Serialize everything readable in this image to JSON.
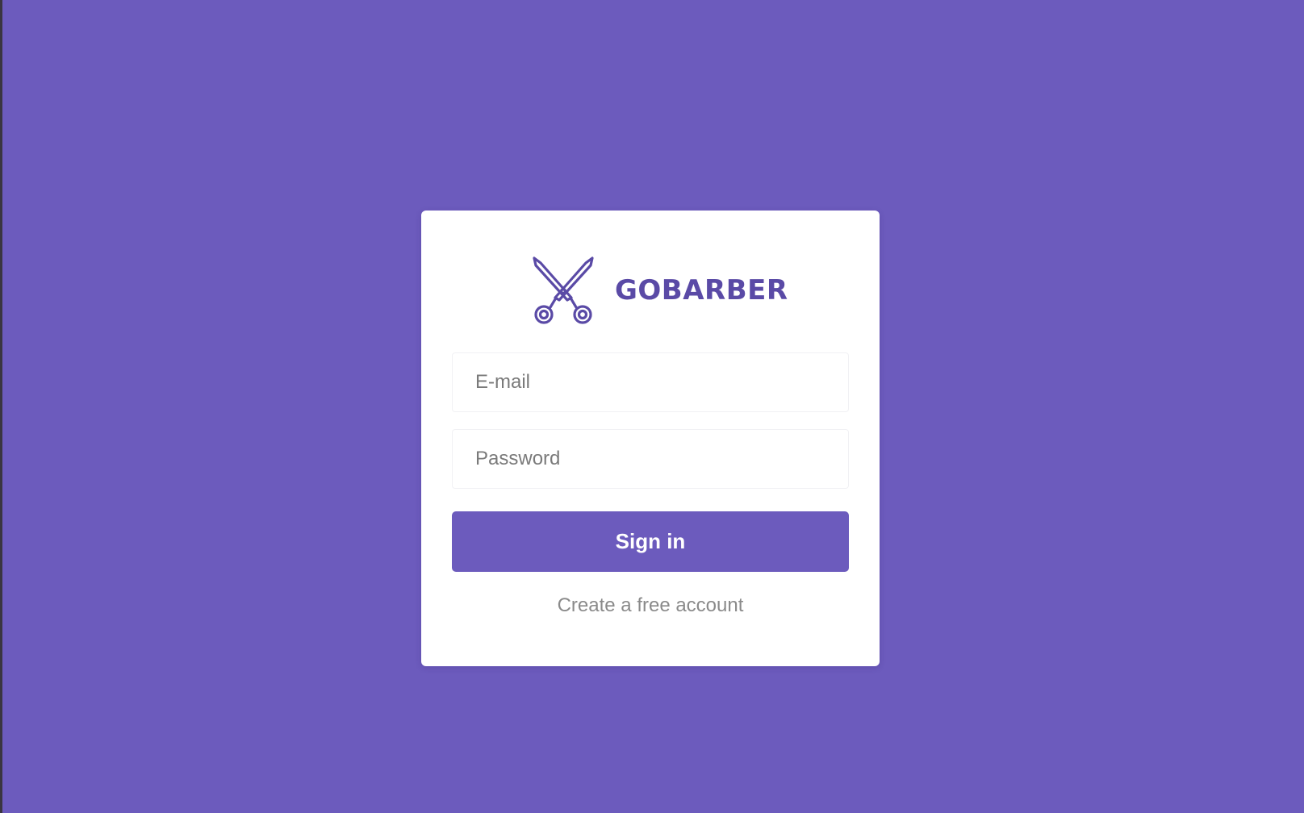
{
  "brand": {
    "name": "GOBARBER",
    "icon": "scissors-icon",
    "color": "#5a4aa6"
  },
  "form": {
    "email_placeholder": "E-mail",
    "password_placeholder": "Password",
    "submit_label": "Sign in",
    "signup_link_label": "Create a free account"
  },
  "theme": {
    "background": "#6c5bbd",
    "card": "#ffffff",
    "button": "#6c5bbd"
  }
}
